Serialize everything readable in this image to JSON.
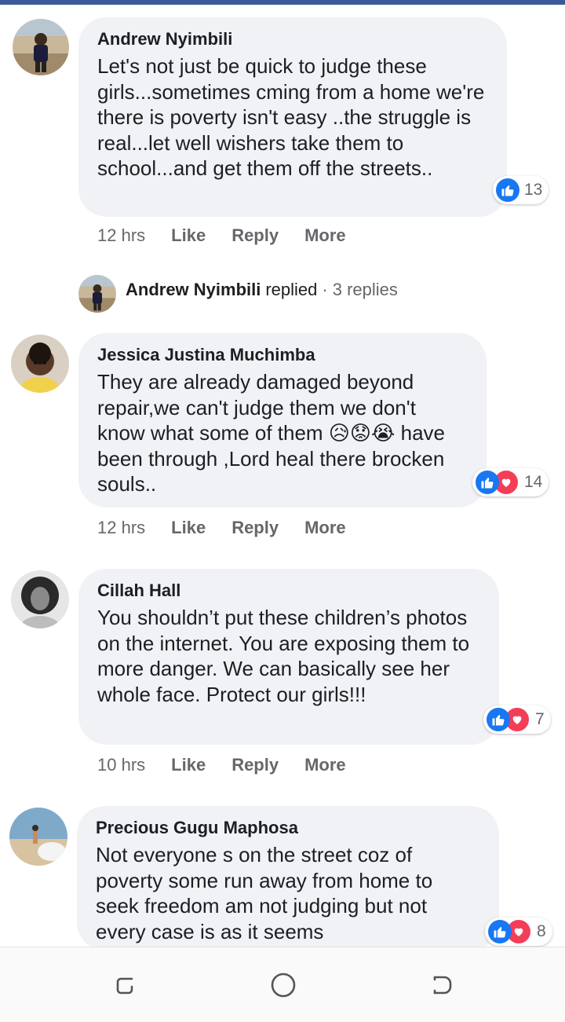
{
  "comments": [
    {
      "author": "Andrew Nyimbili",
      "text": "Let's not just be quick to judge these girls...sometimes cming from a home we're there is poverty isn't easy ..the struggle is real...let well wishers take them to school...and get them off the streets..",
      "time": "12 hrs",
      "reactions": {
        "count": "13",
        "types": [
          "like-icon"
        ]
      }
    },
    {
      "author": "Jessica Justina Muchimba",
      "text": "They are already damaged beyond repair,we can't judge them we don't know what some of them 😥😟😭 have been through ,Lord heal there brocken souls..",
      "time": "12 hrs",
      "reactions": {
        "count": "14",
        "types": [
          "like-icon",
          "love-icon"
        ]
      }
    },
    {
      "author": "Cillah Hall",
      "text": "You shouldn’t put these children’s photos on the internet. You are exposing them to more danger. We can basically see her whole face. Protect our girls!!!",
      "time": "10 hrs",
      "reactions": {
        "count": "7",
        "types": [
          "like-icon",
          "love-icon"
        ]
      }
    },
    {
      "author": "Precious Gugu Maphosa",
      "text": "Not everyone s on the street coz of poverty some run away from home to seek freedom am not judging but not every case is as it seems",
      "reactions": {
        "count": "8",
        "types": [
          "like-icon",
          "love-icon"
        ]
      }
    }
  ],
  "actions": {
    "like": "Like",
    "reply": "Reply",
    "more": "More"
  },
  "replied": {
    "name": "Andrew Nyimbili",
    "verb": "replied",
    "separator": "·",
    "count": "3 replies"
  },
  "colors": {
    "brand": "#3b5998",
    "like": "#1877f2",
    "love": "#f33e58",
    "bubble": "#f0f2f5",
    "muted": "#65676b"
  },
  "navigation": {
    "icons": [
      "recent-apps-icon",
      "home-icon",
      "back-icon"
    ]
  }
}
